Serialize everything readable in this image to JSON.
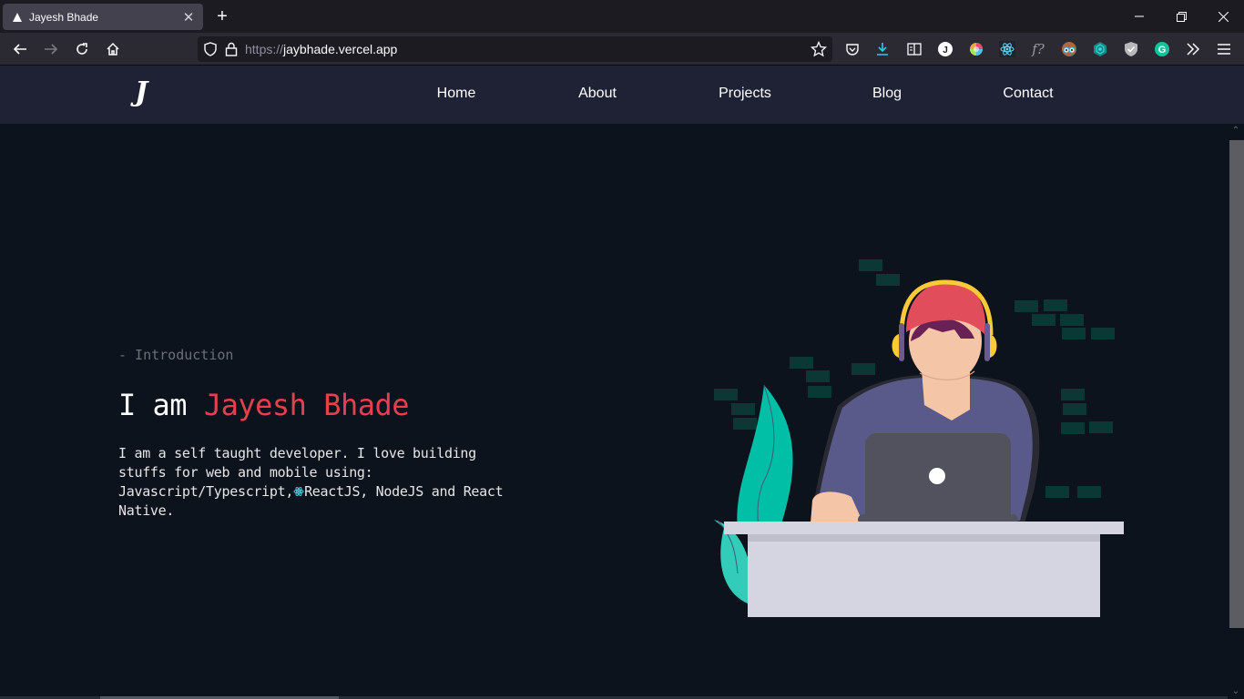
{
  "browser": {
    "tab_title": "Jayesh Bhade",
    "url_scheme": "https://",
    "url_host": "jaybhade.vercel.app",
    "extensions": [
      "pocket-icon",
      "downloads-icon",
      "reader-view-icon",
      "profile-j-icon",
      "color-picker-icon",
      "react-devtools-icon",
      "whatfont-icon",
      "owl-extension-icon",
      "web-extension-icon",
      "adblock-shield-icon",
      "grammarly-icon",
      "overflow-menu-icon",
      "hamburger-menu-icon"
    ],
    "profile_initial": "J",
    "whatfont_label": "f?",
    "grammarly_initial": "G"
  },
  "site": {
    "logo": "J",
    "nav": [
      {
        "label": "Home"
      },
      {
        "label": "About"
      },
      {
        "label": "Projects"
      },
      {
        "label": "Blog"
      },
      {
        "label": "Contact"
      }
    ]
  },
  "hero": {
    "intro": "- Introduction",
    "headline_prefix": "I am ",
    "headline_name": "Jayesh Bhade",
    "bio_part1": "I am a self taught developer. I love building stuffs for web and mobile using: Javascript/Typescript,",
    "bio_part2": "ReactJS, NodeJS and React Native.",
    "accent_color": "#e5404d"
  }
}
